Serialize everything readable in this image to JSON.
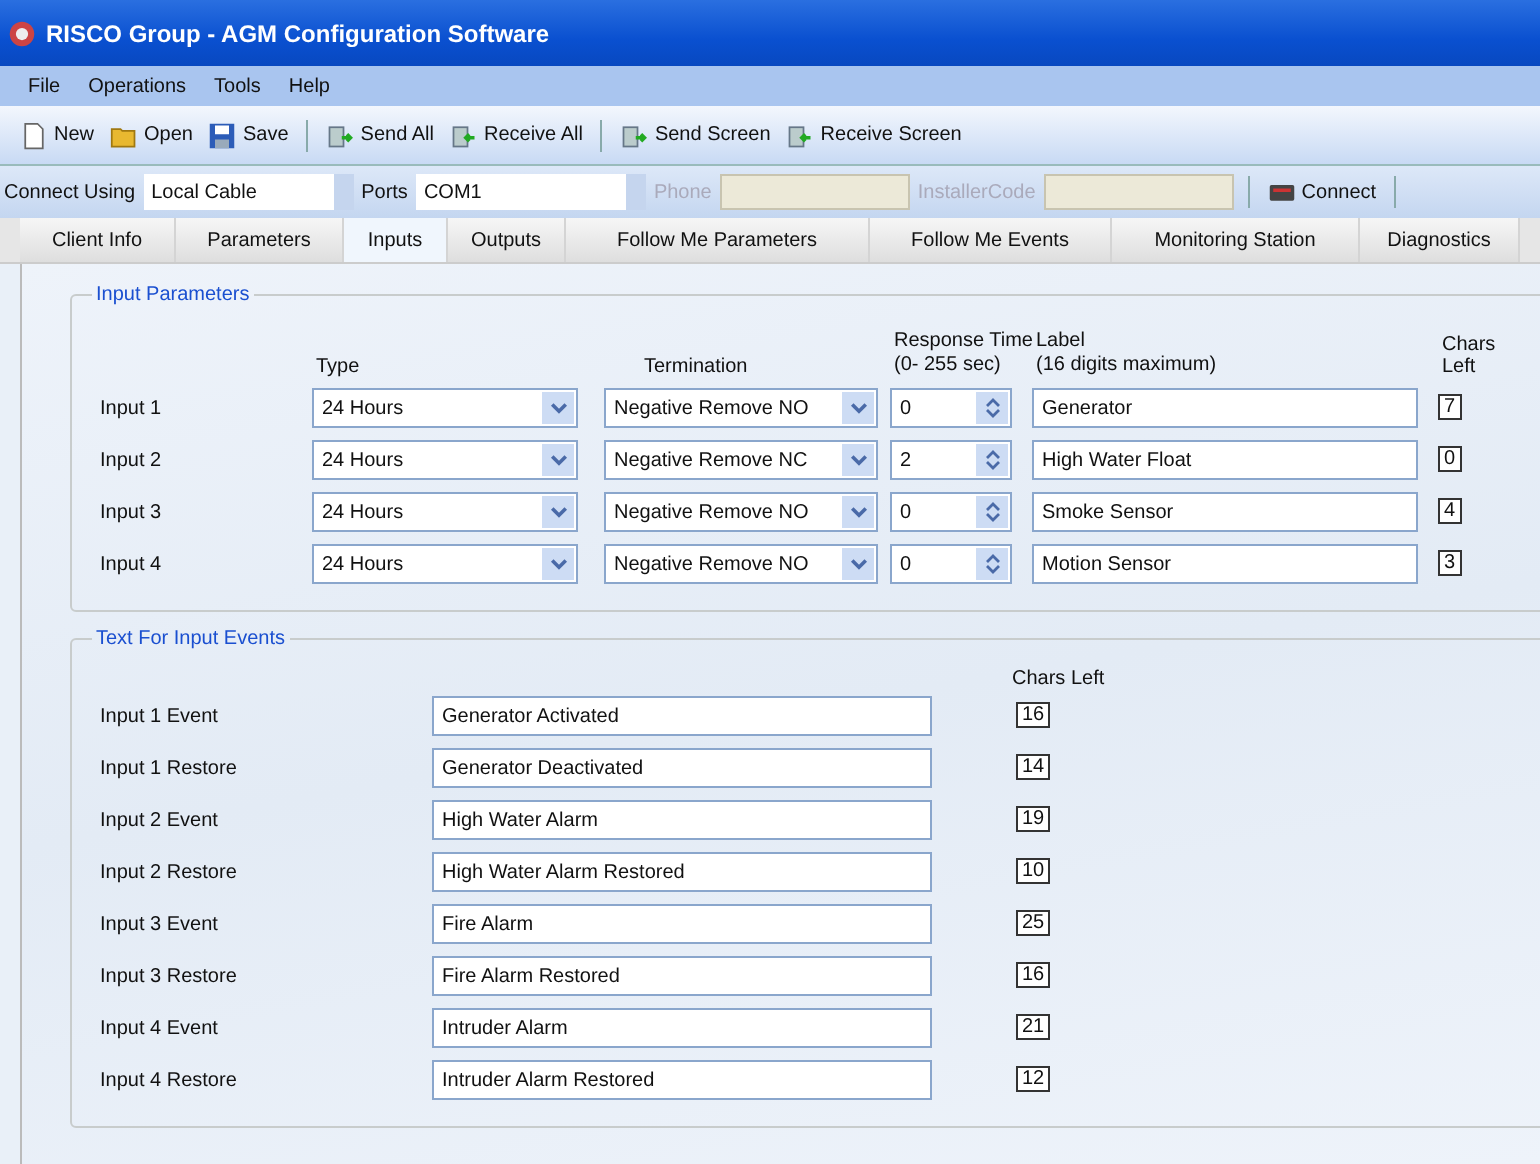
{
  "window": {
    "title": "RISCO Group - AGM Configuration Software"
  },
  "menu": [
    "File",
    "Operations",
    "Tools",
    "Help"
  ],
  "toolbar": [
    [
      {
        "label": "New",
        "kind": "new"
      },
      {
        "label": "Open",
        "kind": "open"
      },
      {
        "label": "Save",
        "kind": "save"
      }
    ],
    [
      {
        "label": "Send All",
        "kind": "send"
      },
      {
        "label": "Receive All",
        "kind": "receive"
      }
    ],
    [
      {
        "label": "Send Screen",
        "kind": "send"
      },
      {
        "label": "Receive Screen",
        "kind": "receive"
      }
    ]
  ],
  "connect_bar": {
    "connect_using_label": "Connect Using",
    "connect_using": "Local Cable",
    "ports_label": "Ports",
    "ports": "COM1",
    "phone_label": "Phone",
    "installer_code_label": "InstallerCode",
    "connect_button": "Connect"
  },
  "tabs": [
    {
      "label": "Client Info",
      "selected": false
    },
    {
      "label": "Parameters",
      "selected": false
    },
    {
      "label": "Inputs",
      "selected": true
    },
    {
      "label": "Outputs",
      "selected": false
    },
    {
      "label": "Follow Me Parameters",
      "selected": false
    },
    {
      "label": "Follow Me Events",
      "selected": false
    },
    {
      "label": "Monitoring Station",
      "selected": false
    },
    {
      "label": "Diagnostics",
      "selected": false
    }
  ],
  "input_parameters": {
    "title": "Input Parameters",
    "headers": {
      "type": "Type",
      "termination": "Termination",
      "response_time": "Response Time",
      "response_range": "(0- 255 sec)",
      "label": "Label",
      "label_hint": "(16 digits maximum)",
      "chars_left": "Chars Left"
    },
    "rows": [
      {
        "name": "Input 1",
        "type": "24 Hours",
        "termination": "Negative Remove NO",
        "response_time": "0",
        "label": "Generator",
        "chars_left": "7"
      },
      {
        "name": "Input 2",
        "type": "24 Hours",
        "termination": "Negative Remove NC",
        "response_time": "2",
        "label": "High Water Float",
        "chars_left": "0"
      },
      {
        "name": "Input 3",
        "type": "24 Hours",
        "termination": "Negative Remove NO",
        "response_time": "0",
        "label": "Smoke Sensor",
        "chars_left": "4"
      },
      {
        "name": "Input 4",
        "type": "24 Hours",
        "termination": "Negative Remove NO",
        "response_time": "0",
        "label": "Motion Sensor",
        "chars_left": "3"
      }
    ]
  },
  "input_events": {
    "title": "Text For Input Events",
    "chars_left_header": "Chars Left",
    "rows": [
      {
        "name": "Input 1 Event",
        "text": "Generator Activated",
        "chars_left": "16"
      },
      {
        "name": "Input 1 Restore",
        "text": "Generator Deactivated",
        "chars_left": "14"
      },
      {
        "name": "Input 2 Event",
        "text": "High Water Alarm",
        "chars_left": "19"
      },
      {
        "name": "Input 2 Restore",
        "text": "High Water Alarm Restored",
        "chars_left": "10"
      },
      {
        "name": "Input 3 Event",
        "text": "Fire Alarm",
        "chars_left": "25"
      },
      {
        "name": "Input 3 Restore",
        "text": "Fire Alarm Restored",
        "chars_left": "16"
      },
      {
        "name": "Input 4 Event",
        "text": "Intruder Alarm",
        "chars_left": "21"
      },
      {
        "name": "Input 4 Restore",
        "text": "Intruder Alarm Restored",
        "chars_left": "12"
      }
    ]
  }
}
